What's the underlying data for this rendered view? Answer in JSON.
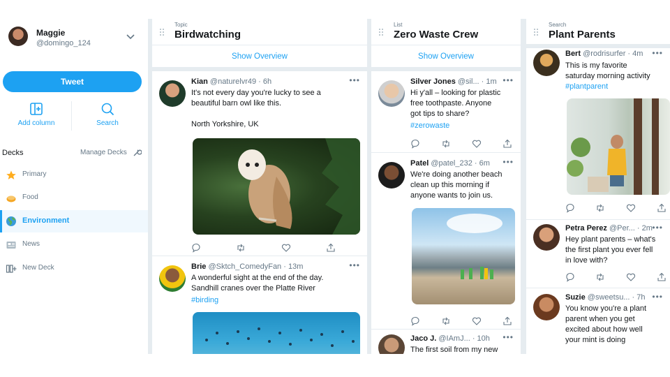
{
  "colors": {
    "accent": "#1da1f2",
    "text": "#14171a",
    "muted": "#657786",
    "divider": "#e6ecf0"
  },
  "sidebar": {
    "account": {
      "name": "Maggie",
      "handle": "@domingo_124"
    },
    "tweet_button": "Tweet",
    "actions": [
      {
        "label": "Add column",
        "icon": "add-column-icon"
      },
      {
        "label": "Search",
        "icon": "search-icon"
      }
    ],
    "decks_title": "Decks",
    "manage_decks": "Manage Decks",
    "decks": [
      {
        "label": "Primary",
        "icon": "star-icon"
      },
      {
        "label": "Food",
        "icon": "food-icon"
      },
      {
        "label": "Environment",
        "icon": "globe-icon",
        "active": true
      },
      {
        "label": "News",
        "icon": "news-icon"
      },
      {
        "label": "New Deck",
        "icon": "new-deck-icon"
      }
    ]
  },
  "columns": [
    {
      "kind": "Topic",
      "title": "Birdwatching",
      "show_overview": "Show Overview",
      "tweets": [
        {
          "name": "Kian",
          "handle": "@naturelvr49 · 6h",
          "body": "It's not every day you're lucky to see a\nbeautiful barn owl like this.\n\nNorth Yorkshire, UK",
          "media": "barn-owl-photo"
        },
        {
          "name": "Brie",
          "handle": "@Sktch_ComedyFan · 13m",
          "body": "A wonderful sight at the end of the day.\nSandhill cranes over the Platte River",
          "hashtag": "#birding",
          "media": "cranes-photo"
        }
      ]
    },
    {
      "kind": "List",
      "title": "Zero Waste Crew",
      "show_overview": "Show Overview",
      "tweets": [
        {
          "name": "Silver Jones",
          "handle": "@sil... · 1m",
          "body": "Hi y'all – looking for plastic\nfree toothpaste. Anyone\ngot tips to share?",
          "hashtag": "#zerowaste"
        },
        {
          "name": "Patel",
          "handle": "@patel_232 · 6m",
          "body": "We're doing another beach\nclean up this morning if\nanyone wants to join us.",
          "media": "beach-cleanup-photo"
        },
        {
          "name": "Jaco J.",
          "handle": "@IAmJ... · 10h",
          "body": "The first soil from my new"
        }
      ]
    },
    {
      "kind": "Search",
      "title": "Plant Parents",
      "tweets": [
        {
          "name": "Bert",
          "handle": "@rodrisurfer · 4m",
          "body": "This is my favorite\nsaturday morning activity",
          "hashtag": "#plantparent",
          "media": "plant-photo"
        },
        {
          "name": "Petra Perez",
          "handle": "@Per... · 2m",
          "body": "Hey plant parents – what's\nthe first plant you ever fell\nin love with?"
        },
        {
          "name": "Suzie",
          "handle": "@sweetsu... · 7h",
          "body": "You know you're a plant\nparent when you get\nexcited about how well\nyour mint is doing"
        }
      ]
    }
  ],
  "tweet_actions": [
    "reply-icon",
    "retweet-icon",
    "like-icon",
    "share-icon"
  ]
}
